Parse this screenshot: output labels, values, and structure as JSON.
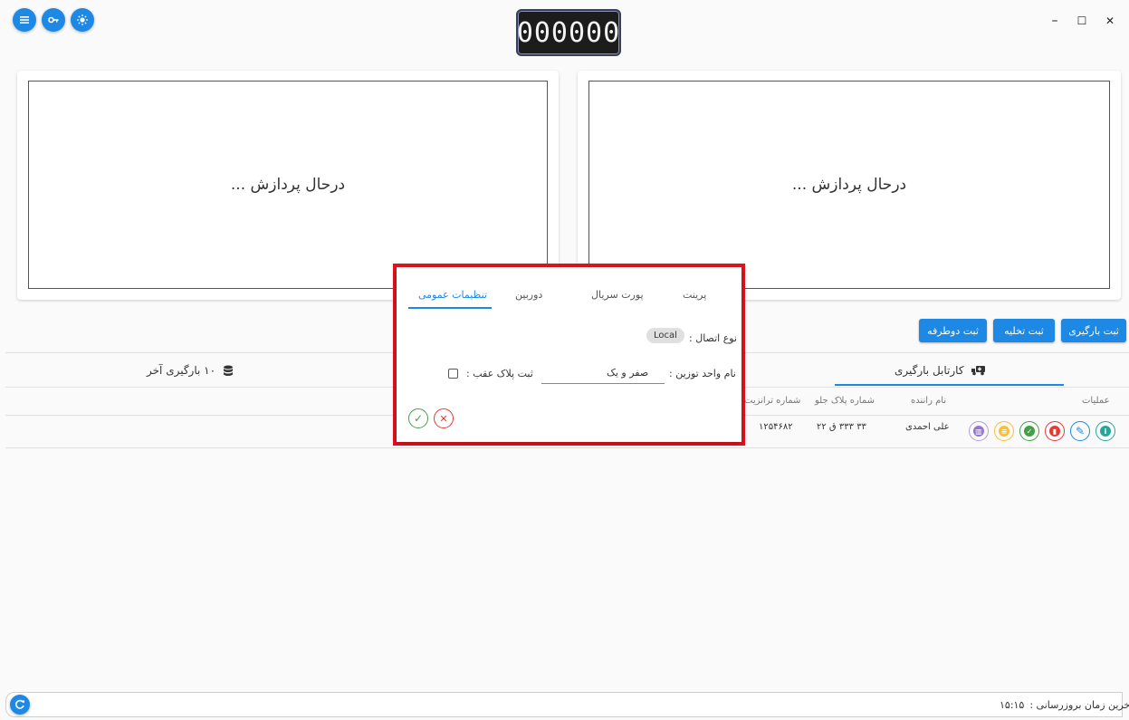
{
  "counter": {
    "value": "000000"
  },
  "top_buttons": [
    {
      "icon": "menu-icon"
    },
    {
      "icon": "key-icon"
    },
    {
      "icon": "brightness-icon"
    }
  ],
  "window": {
    "minimize": "–",
    "maximize": "☐",
    "close": "✕"
  },
  "cameras": [
    {
      "status": "درحال پردازش ..."
    },
    {
      "status": "درحال پردازش ..."
    }
  ],
  "actions": {
    "load": "ثبت بارگیری",
    "unload": "ثبت تخلیه",
    "two_way": "ثبت دوطرفه"
  },
  "tabs": {
    "cartable": "کارتابل بارگیری",
    "last_loads": "۱۰ بارگیری آخر"
  },
  "table": {
    "headers": {
      "operations": "عملیات",
      "driver": "نام راننده",
      "plate": "شماره پلاک جلو",
      "transit": "شماره ترانزیت"
    },
    "rows": [
      {
        "driver": "علی احمدی",
        "plate": "۳۳ ۳۳۳ ق ۲۲",
        "transit": "۱۲۵۴۶۸۲"
      }
    ]
  },
  "dialog": {
    "tabs": {
      "general": "تنظیمات عمومی",
      "camera": "دوربین",
      "serial": "پورت سریال",
      "print": "پرینت"
    },
    "connection_label": "نوع اتصال :",
    "connection_value": "Local",
    "unit_label": "نام واحد توزین :",
    "unit_value": "صفر و یک",
    "rear_plate_label": "ثبت پلاک عقب :"
  },
  "footer": {
    "last_update_label": "آخرین زمان بروزرسانی :",
    "last_update_value": "۱۵:۱۵"
  },
  "colors": {
    "primary": "#1e88e5",
    "highlight": "#e0141e",
    "success": "#43a047",
    "danger": "#e53935"
  }
}
